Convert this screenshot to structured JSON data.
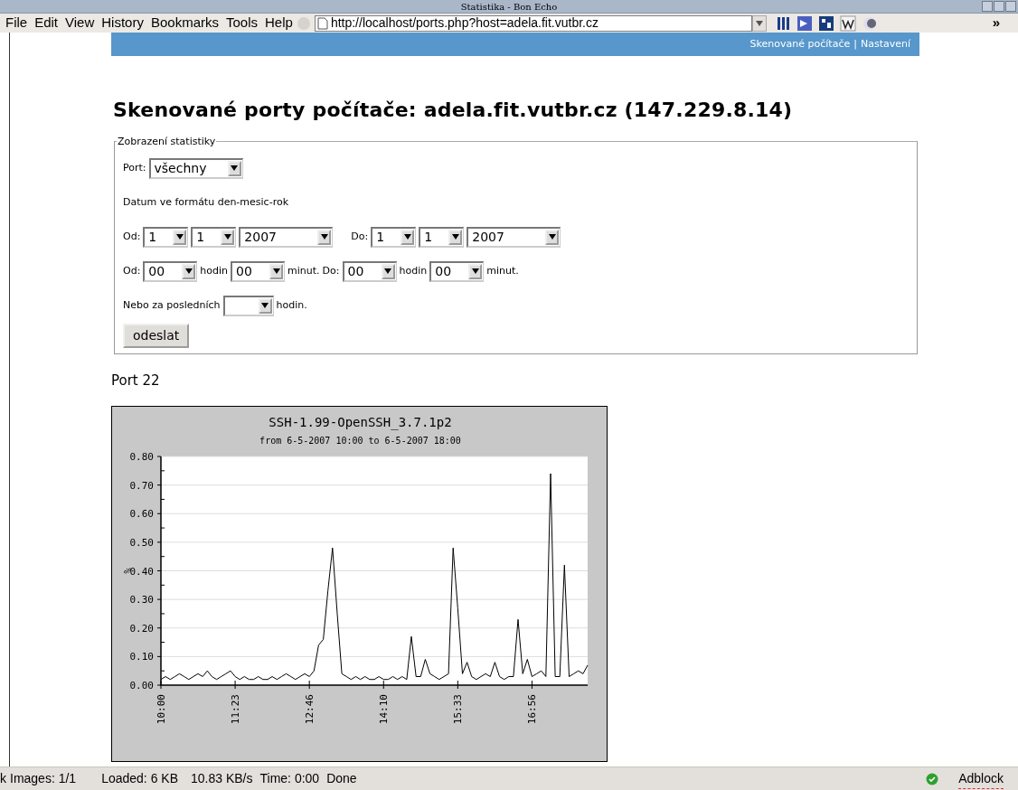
{
  "window": {
    "title": "Statistika - Bon Echo"
  },
  "menu": [
    "File",
    "Edit",
    "View",
    "History",
    "Bookmarks",
    "Tools",
    "Help"
  ],
  "address_bar": {
    "value": "http://localhost/ports.php?host=adela.fit.vutbr.cz"
  },
  "toolbar_extra": "»",
  "nav_links": [
    {
      "label": "Skenované počítače"
    },
    {
      "label": "Nastavení"
    }
  ],
  "nav_separator": "|",
  "heading": "Skenované porty počítače: adela.fit.vutbr.cz (147.229.8.14)",
  "form": {
    "legend": "Zobrazení statistiky",
    "rows": [
      {
        "items": [
          {
            "kind": "label",
            "text": "Port:"
          },
          {
            "kind": "select",
            "value": "všechny"
          }
        ]
      },
      {
        "items": [
          {
            "kind": "label",
            "text": "Datum ve formátu den-mesic-rok"
          }
        ]
      },
      {
        "items": [
          {
            "kind": "label",
            "text": "Od:"
          },
          {
            "kind": "select",
            "value": "1"
          },
          {
            "kind": "select",
            "value": "1"
          },
          {
            "kind": "select",
            "value": "2007"
          },
          {
            "kind": "gap"
          },
          {
            "kind": "label",
            "text": "Do:"
          },
          {
            "kind": "select",
            "value": "1"
          },
          {
            "kind": "select",
            "value": "1"
          },
          {
            "kind": "select",
            "value": "2007"
          }
        ]
      },
      {
        "items": [
          {
            "kind": "label",
            "text": "Od:"
          },
          {
            "kind": "select",
            "value": "00"
          },
          {
            "kind": "label",
            "text": "hodin"
          },
          {
            "kind": "select",
            "value": "00"
          },
          {
            "kind": "label",
            "text": "minut."
          },
          {
            "kind": "label",
            "text": "Do:"
          },
          {
            "kind": "select",
            "value": "00"
          },
          {
            "kind": "label",
            "text": "hodin"
          },
          {
            "kind": "select",
            "value": "00"
          },
          {
            "kind": "label",
            "text": "minut."
          }
        ]
      },
      {
        "items": [
          {
            "kind": "label",
            "text": "Nebo za posledních"
          },
          {
            "kind": "select"
          },
          {
            "kind": "label",
            "text": "hodin."
          }
        ]
      }
    ],
    "submit": "odeslat"
  },
  "section_title": "Port 22",
  "chart": {
    "title": "SSH-1.99-OpenSSH_3.7.1p2",
    "subtitle": "from 6-5-2007 10:00 to 6-5-2007 18:00",
    "chart_data": {
      "type": "line",
      "grid": true,
      "ylabel": "%",
      "ylim": [
        0,
        0.8
      ],
      "yticks": [
        {
          "value": 0,
          "label": "0.00"
        },
        {
          "value": 0.1,
          "label": "0.10"
        },
        {
          "value": 0.2,
          "label": "0.20"
        },
        {
          "value": 0.3,
          "label": "0.30"
        },
        {
          "value": 0.4,
          "label": "0.40"
        },
        {
          "value": 0.5,
          "label": "0.50"
        },
        {
          "value": 0.6,
          "label": "0.60"
        },
        {
          "value": 0.7,
          "label": "0.70"
        },
        {
          "value": 0.8,
          "label": "0.80"
        }
      ],
      "categories": [
        "10:00",
        null,
        null,
        null,
        null,
        null,
        null,
        null,
        null,
        null,
        null,
        null,
        null,
        null,
        null,
        null,
        "11:23",
        null,
        null,
        null,
        null,
        null,
        null,
        null,
        null,
        null,
        null,
        null,
        null,
        null,
        null,
        null,
        "12:46",
        null,
        null,
        null,
        null,
        null,
        null,
        null,
        null,
        null,
        null,
        null,
        null,
        null,
        null,
        null,
        "14:10",
        null,
        null,
        null,
        null,
        null,
        null,
        null,
        null,
        null,
        null,
        null,
        null,
        null,
        null,
        null,
        "15:33",
        null,
        null,
        null,
        null,
        null,
        null,
        null,
        null,
        null,
        null,
        null,
        null,
        null,
        null,
        null,
        "16:56",
        null,
        null,
        null,
        null,
        null,
        null,
        null,
        null,
        null,
        null,
        null,
        null
      ],
      "series": [
        {
          "color": "#000000",
          "values": [
            0.02,
            0.03,
            0.02,
            0.03,
            0.04,
            0.03,
            0.02,
            0.03,
            0.04,
            0.03,
            0.05,
            0.03,
            0.02,
            0.03,
            0.04,
            0.05,
            0.03,
            0.02,
            0.03,
            0.02,
            0.02,
            0.03,
            0.02,
            0.02,
            0.03,
            0.02,
            0.03,
            0.04,
            0.03,
            0.02,
            0.03,
            0.04,
            0.03,
            0.05,
            0.14,
            0.16,
            0.33,
            0.48,
            0.25,
            0.04,
            0.03,
            0.02,
            0.03,
            0.02,
            0.03,
            0.02,
            0.02,
            0.03,
            0.02,
            0.02,
            0.03,
            0.02,
            0.03,
            0.02,
            0.17,
            0.03,
            0.03,
            0.09,
            0.04,
            0.03,
            0.02,
            0.03,
            0.04,
            0.48,
            0.27,
            0.04,
            0.08,
            0.03,
            0.02,
            0.03,
            0.04,
            0.03,
            0.08,
            0.03,
            0.02,
            0.03,
            0.03,
            0.23,
            0.04,
            0.09,
            0.03,
            0.04,
            0.05,
            0.03,
            0.74,
            0.03,
            0.03,
            0.42,
            0.03,
            0.04,
            0.05,
            0.04,
            0.07
          ]
        }
      ]
    }
  },
  "status_bar": {
    "fragment": "k",
    "items": [
      "Images: 1/1",
      "Loaded: 6 KB",
      "10.83 KB/s",
      "Time: 0:00",
      "Done"
    ],
    "adblock": "Adblock"
  }
}
